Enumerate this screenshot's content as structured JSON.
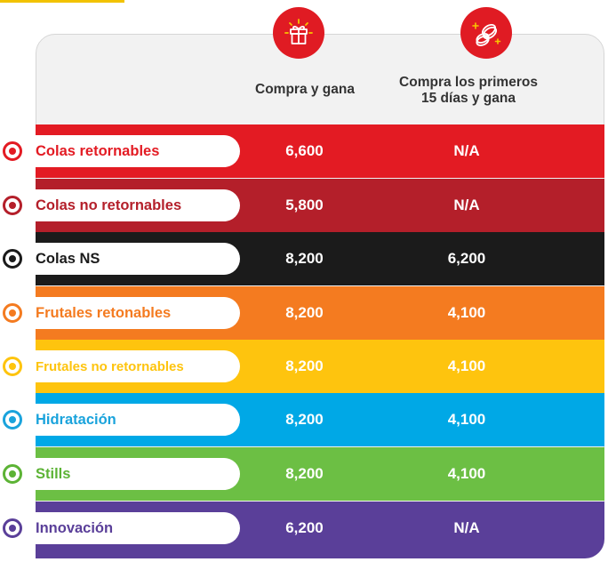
{
  "header": {
    "col1": "Compra y gana",
    "col2": "Compra los primeros\n15 días y gana"
  },
  "icons": {
    "col1": "gift-icon",
    "col2": "coins-icon",
    "accent": "#e01b23"
  },
  "rows": [
    {
      "label": "Colas retornables",
      "v1": "6,600",
      "v2": "N/A",
      "color": "#e31b23",
      "text_color": "#e31b23"
    },
    {
      "label": "Colas no retornables",
      "v1": "5,800",
      "v2": "N/A",
      "color": "#b41f2a",
      "text_color": "#b41f2a"
    },
    {
      "label": "Colas NS",
      "v1": "8,200",
      "v2": "6,200",
      "color": "#1b1b1b",
      "text_color": "#1b1b1b"
    },
    {
      "label": "Frutales retonables",
      "v1": "8,200",
      "v2": "4,100",
      "color": "#f47b20",
      "text_color": "#f47b20"
    },
    {
      "label": "Frutales no retornables",
      "v1": "8,200",
      "v2": "4,100",
      "color": "#fec40e",
      "text_color": "#fec40e"
    },
    {
      "label": "Hidratación",
      "v1": "8,200",
      "v2": "4,100",
      "color": "#00a8e6",
      "text_color": "#1aa3dc"
    },
    {
      "label": "Stills",
      "v1": "8,200",
      "v2": "4,100",
      "color": "#6cbf44",
      "text_color": "#5cb335"
    },
    {
      "label": "Innovación",
      "v1": "6,200",
      "v2": "N/A",
      "color": "#5a3f99",
      "text_color": "#5a3f99"
    }
  ]
}
